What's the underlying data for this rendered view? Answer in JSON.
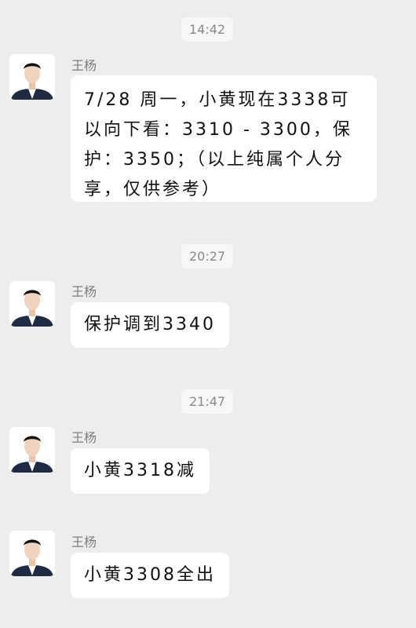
{
  "messages": [
    {
      "time": "14:42",
      "sender": "王杨",
      "text": "7/28 周一，小黄现在3338可以向下看：3310 - 3300，保护：3350；（以上纯属个人分享，仅供参考）"
    },
    {
      "time": "20:27",
      "sender": "王杨",
      "text": "保护调到3340"
    },
    {
      "time": "21:47",
      "sender": "王杨",
      "text": "小黄3318减"
    },
    {
      "time": "",
      "sender": "王杨",
      "text": "小黄3308全出"
    }
  ]
}
